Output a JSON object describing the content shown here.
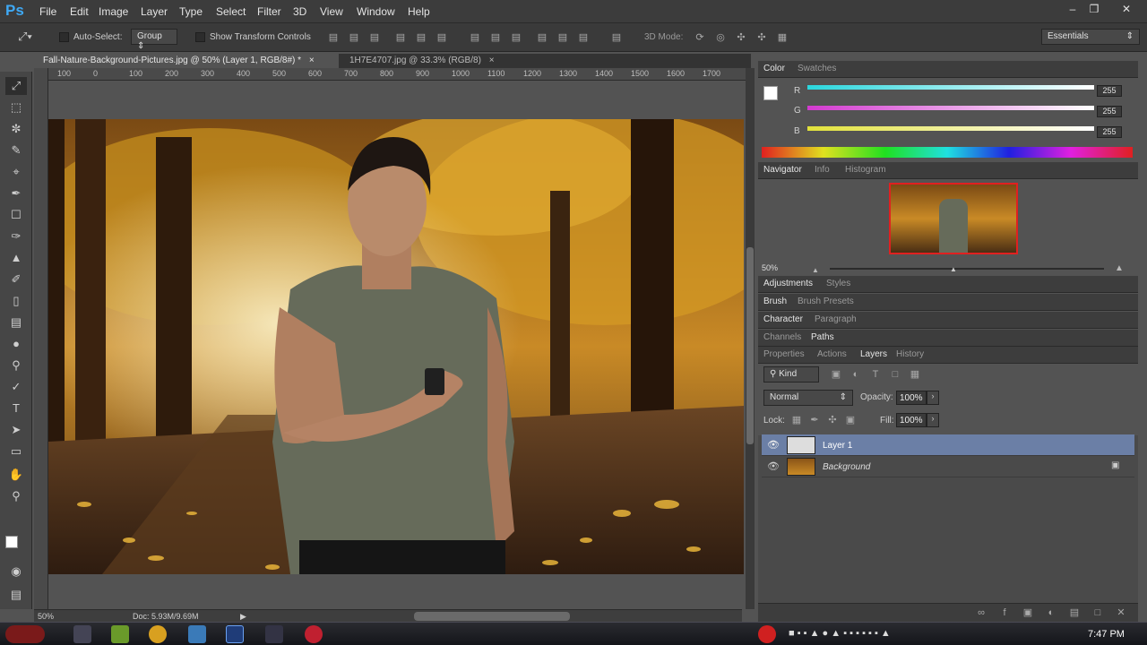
{
  "app": {
    "logo": "Ps"
  },
  "menu": [
    "File",
    "Edit",
    "Image",
    "Layer",
    "Type",
    "Select",
    "Filter",
    "3D",
    "View",
    "Window",
    "Help"
  ],
  "options": {
    "auto_select_label": "Auto-Select:",
    "auto_select_value": "Group",
    "transform_label": "Show Transform Controls",
    "mode_label": "3D Mode:",
    "workspace": "Essentials"
  },
  "tabs": [
    {
      "label": "Fall-Nature-Background-Pictures.jpg @ 50% (Layer 1, RGB/8#) *",
      "active": true
    },
    {
      "label": "1H7E4707.jpg @ 33.3% (RGB/8)",
      "active": false
    }
  ],
  "ruler_top": [
    "100",
    "0",
    "100",
    "200",
    "300",
    "400",
    "500",
    "600",
    "700",
    "800",
    "900",
    "1000",
    "1100",
    "1200",
    "1300",
    "1400",
    "1500",
    "1600",
    "1700"
  ],
  "status": {
    "zoom": "50%",
    "doc": "Doc: 5.93M/9.69M"
  },
  "color_panel": {
    "tabs": [
      "Color",
      "Swatches"
    ],
    "channels": [
      {
        "label": "R",
        "value": "255",
        "color": "#38d3d9"
      },
      {
        "label": "G",
        "value": "255",
        "color": "#d040c8"
      },
      {
        "label": "B",
        "value": "255",
        "color": "#e0e040"
      }
    ]
  },
  "navigator": {
    "tabs": [
      "Navigator",
      "Info",
      "Histogram"
    ],
    "zoom": "50%"
  },
  "groups": [
    [
      "Adjustments",
      "Styles"
    ],
    [
      "Brush",
      "Brush Presets"
    ],
    [
      "Character",
      "Paragraph"
    ],
    [
      "Channels",
      "Paths"
    ]
  ],
  "layers_panel": {
    "tabs": [
      "Properties",
      "Actions",
      "Layers",
      "History"
    ],
    "kind_label": "Kind",
    "blend_mode": "Normal",
    "opacity_label": "Opacity:",
    "opacity_value": "100%",
    "lock_label": "Lock:",
    "fill_label": "Fill:",
    "fill_value": "100%",
    "layers": [
      {
        "name": "Layer 1",
        "selected": true
      },
      {
        "name": "Background",
        "selected": false
      }
    ]
  },
  "taskbar": {
    "time": "7:47 PM"
  }
}
